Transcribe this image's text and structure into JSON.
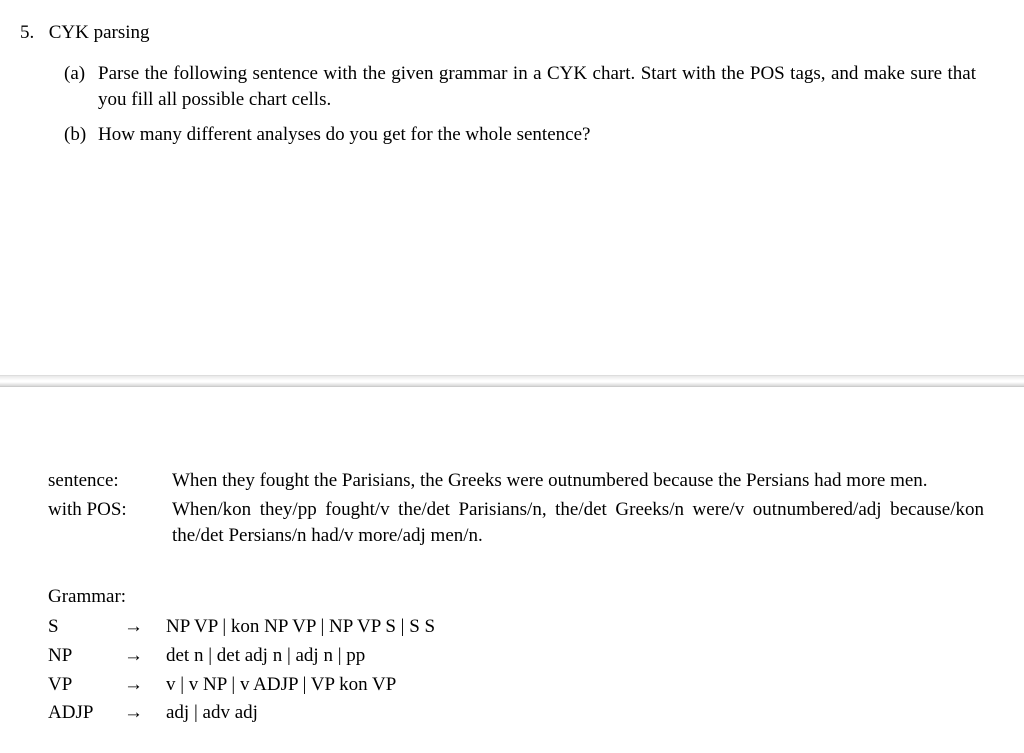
{
  "question": {
    "number": "5.",
    "title": "CYK parsing",
    "parts": [
      {
        "label": "(a)",
        "text": "Parse the following sentence with the given grammar in a CYK chart. Start with the POS tags, and make sure that you fill all possible chart cells."
      },
      {
        "label": "(b)",
        "text": "How many different analyses do you get for the whole sentence?"
      }
    ]
  },
  "sentence": {
    "label": "sentence:",
    "text": "When they fought the Parisians, the Greeks were outnumbered because the Persians had more men."
  },
  "pos": {
    "label": "with POS:",
    "text": "When/kon they/pp fought/v the/det Parisians/n, the/det Greeks/n were/v outnumbered/adj because/kon the/det Persians/n had/v more/adj men/n."
  },
  "grammar": {
    "heading": "Grammar:",
    "arrow": "→",
    "rules": [
      {
        "nt": "S",
        "rhs": "NP VP | kon NP VP | NP VP S | S S"
      },
      {
        "nt": "NP",
        "rhs": "det n | det adj n | adj n | pp"
      },
      {
        "nt": "VP",
        "rhs": "v | v NP | v ADJP | VP kon VP"
      },
      {
        "nt": "ADJP",
        "rhs": "adj | adv adj"
      }
    ]
  }
}
